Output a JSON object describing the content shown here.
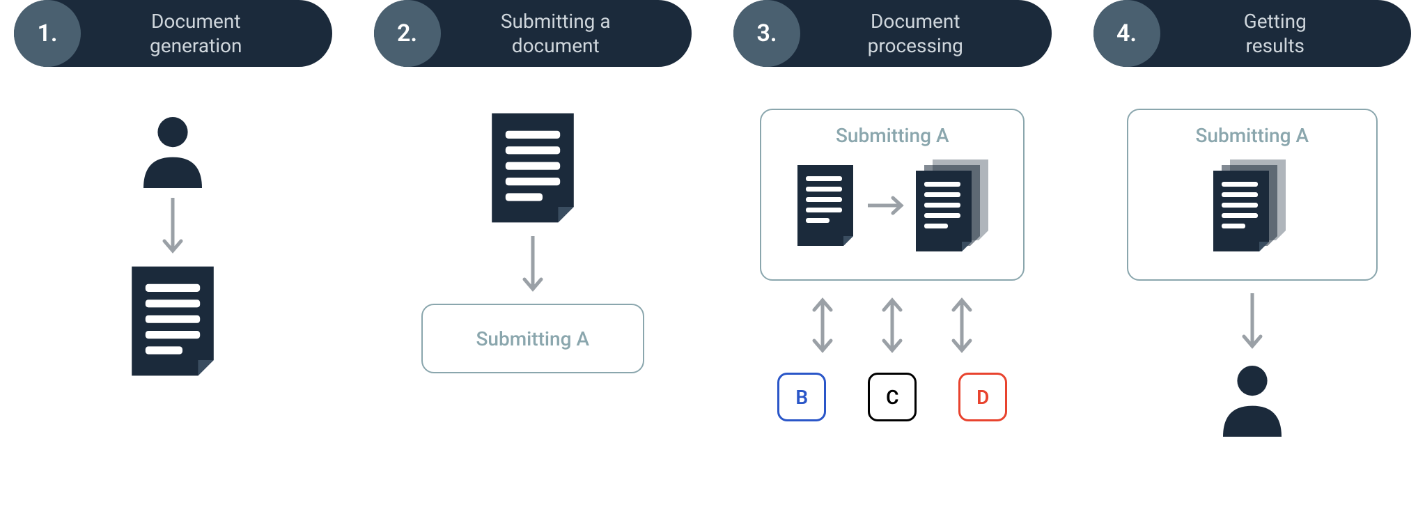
{
  "colors": {
    "pill_bg": "#1b2a3b",
    "num_circle_bg": "#4a6070",
    "text_light": "#cfd6dc",
    "box_border": "#8aa6ad",
    "box_text": "#8aa6ad",
    "arrow": "#9aa0a6",
    "doc_fill": "#1b2a3b",
    "node_b_border": "#2a56c8",
    "node_b_text": "#2a56c8",
    "node_c_border": "#000000",
    "node_c_text": "#000000",
    "node_d_border": "#e8432e",
    "node_d_text": "#e8432e"
  },
  "steps": [
    {
      "num": "1.",
      "title_l1": "Document",
      "title_l2": "generation"
    },
    {
      "num": "2.",
      "title_l1": "Submitting a",
      "title_l2": "document"
    },
    {
      "num": "3.",
      "title_l1": "Document",
      "title_l2": "processing"
    },
    {
      "num": "4.",
      "title_l1": "Getting",
      "title_l2": "results"
    }
  ],
  "labels": {
    "submitting_a": "Submitting A"
  },
  "nodes": {
    "b": "B",
    "c": "C",
    "d": "D"
  }
}
